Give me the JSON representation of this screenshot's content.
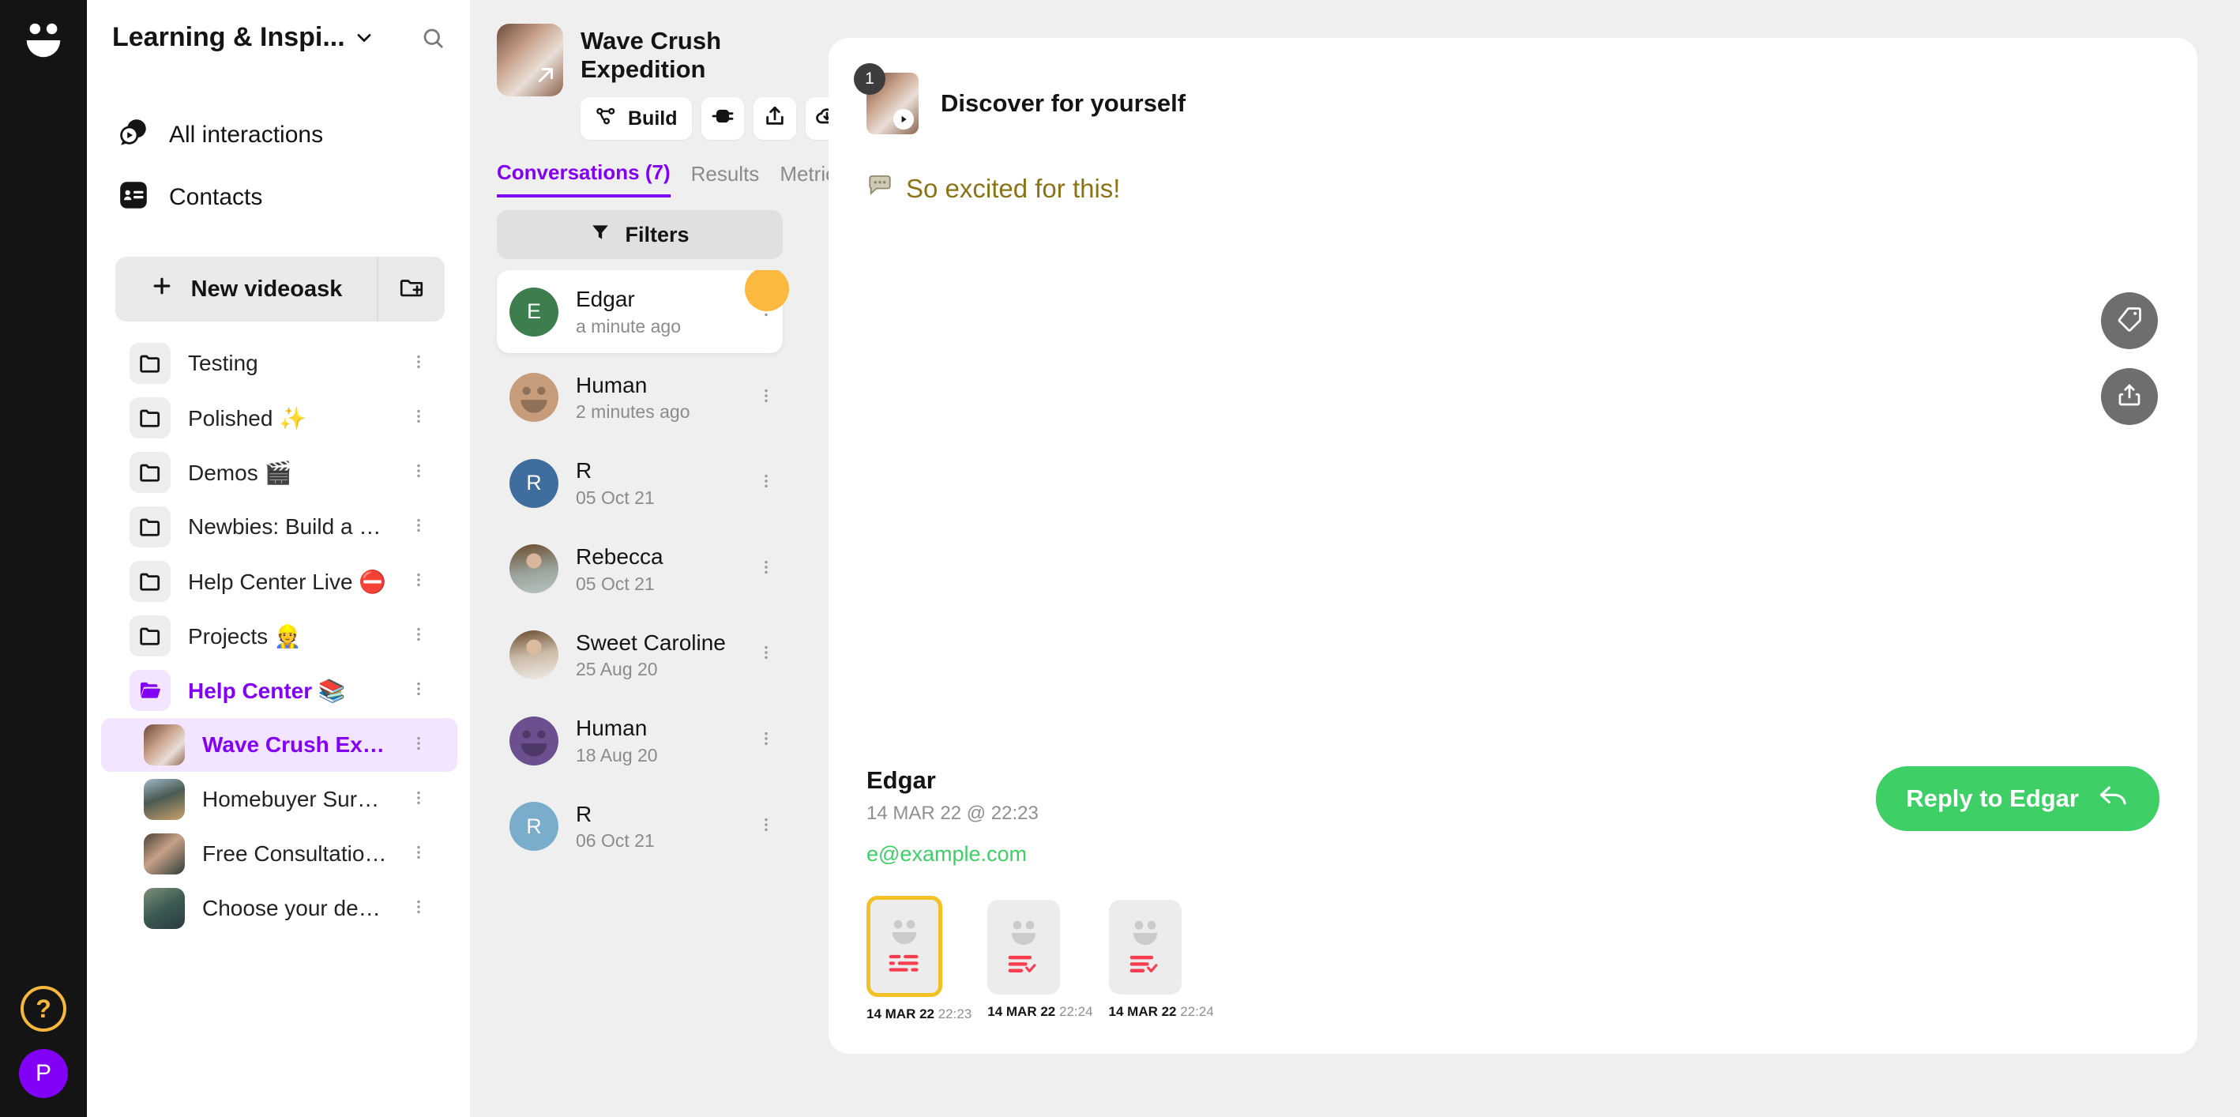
{
  "rail": {
    "logo_icon": "videoask-smiley-logo",
    "help_label": "?",
    "user_initial": "P"
  },
  "sidebar": {
    "workspace_title": "Learning & Inspi...",
    "caret_icon": "chevron-down-icon",
    "search_icon": "search-icon",
    "nav": [
      {
        "label": "All interactions",
        "icon": "all-interactions-icon"
      },
      {
        "label": "Contacts",
        "icon": "contacts-icon"
      }
    ],
    "new_videoask_label": "New videoask",
    "new_videoask_icon": "plus-icon",
    "new_folder_icon": "new-folder-icon",
    "folders": [
      {
        "label": "Testing",
        "type": "folder",
        "selected": false,
        "child": false
      },
      {
        "label": "Polished ✨",
        "type": "folder",
        "selected": false,
        "child": false
      },
      {
        "label": "Demos 🎬",
        "type": "folder",
        "selected": false,
        "child": false
      },
      {
        "label": "Newbies: Build a Vi...",
        "type": "folder",
        "selected": false,
        "child": false
      },
      {
        "label": "Help Center Live ⛔",
        "type": "folder",
        "selected": false,
        "child": false
      },
      {
        "label": "Projects 👷",
        "type": "folder",
        "selected": false,
        "child": false
      },
      {
        "label": "Help Center 📚",
        "type": "folder",
        "selected": true,
        "child": false
      },
      {
        "label": "Wave Crush Expe...",
        "type": "videoask",
        "selected": true,
        "child": true
      },
      {
        "label": "Homebuyer Survey",
        "type": "videoask",
        "selected": false,
        "child": true
      },
      {
        "label": "Free Consultation ...",
        "type": "videoask",
        "selected": false,
        "child": true
      },
      {
        "label": "Choose your desti...",
        "type": "videoask",
        "selected": false,
        "child": true
      }
    ],
    "kebab_icon": "more-vertical-icon"
  },
  "middle": {
    "videoask_title": "Wave Crush Expedition",
    "thumb_expand_icon": "expand-arrow-icon",
    "actions": [
      {
        "label": "Build",
        "icon": "build-flow-icon",
        "icon_only": false
      },
      {
        "label": "",
        "icon": "embed-icon",
        "icon_only": true
      },
      {
        "label": "",
        "icon": "share-upload-icon",
        "icon_only": true
      },
      {
        "label": "",
        "icon": "cloud-download-icon",
        "icon_only": true
      }
    ],
    "tabs": [
      {
        "label": "Conversations (7)",
        "active": true
      },
      {
        "label": "Results",
        "active": false
      },
      {
        "label": "Metrics",
        "active": false
      }
    ],
    "refresh_icon": "refresh-icon",
    "filters_label": "Filters",
    "filters_icon": "filter-icon",
    "conversations": [
      {
        "name": "Edgar",
        "time": "a minute ago",
        "avatar_type": "initial",
        "initial": "E",
        "color": "#3E7D4E",
        "active": true,
        "badge": true
      },
      {
        "name": "Human",
        "time": "2 minutes ago",
        "avatar_type": "smiley",
        "color": "#C69C7B",
        "active": false,
        "badge": false
      },
      {
        "name": "R",
        "time": "05 Oct 21",
        "avatar_type": "initial",
        "initial": "R",
        "color": "#3F6E9E",
        "active": false,
        "badge": false
      },
      {
        "name": "Rebecca",
        "time": "05 Oct 21",
        "avatar_type": "photo",
        "color": "#8a7a6a",
        "active": false,
        "badge": false
      },
      {
        "name": "Sweet Caroline",
        "time": "25 Aug 20",
        "avatar_type": "photo",
        "color": "#93755d",
        "active": false,
        "badge": false
      },
      {
        "name": "Human",
        "time": "18 Aug 20",
        "avatar_type": "smiley",
        "color": "#6B4F8F",
        "active": false,
        "badge": false
      },
      {
        "name": "R",
        "time": "06 Oct 21",
        "avatar_type": "initial",
        "initial": "R",
        "color": "#79ADCB",
        "active": false,
        "badge": false
      }
    ]
  },
  "detail": {
    "step_number": "1",
    "question_title": "Discover for yourself",
    "answer_icon": "speech-bubble-icon",
    "answer_text": "So excited for this!",
    "answer_color": "#8A7416",
    "float_buttons": [
      {
        "icon": "tag-icon"
      },
      {
        "icon": "share-icon"
      }
    ],
    "person_name": "Edgar",
    "person_time": "14 MAR 22 @ 22:23",
    "person_email": "e@example.com",
    "reply_label": "Reply to Edgar",
    "reply_icon": "reply-arrow-icon",
    "reply_color": "#3ECF67",
    "strip": [
      {
        "date": "14 MAR 22",
        "time": "22:23",
        "selected": true,
        "kind": "text-answer"
      },
      {
        "date": "14 MAR 22",
        "time": "22:24",
        "selected": false,
        "kind": "choice-answer"
      },
      {
        "date": "14 MAR 22",
        "time": "22:24",
        "selected": false,
        "kind": "choice-answer"
      }
    ]
  }
}
